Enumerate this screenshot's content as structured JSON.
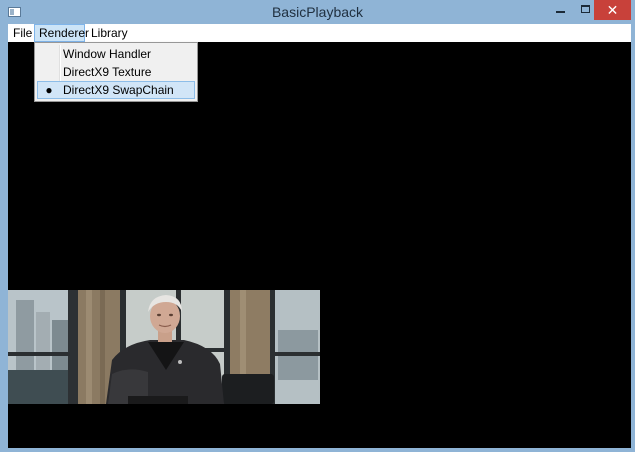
{
  "window": {
    "title": "BasicPlayback",
    "close_glyph": "✕"
  },
  "menubar": {
    "items": [
      {
        "label": "File"
      },
      {
        "label": "Renderer"
      },
      {
        "label": "Library"
      }
    ]
  },
  "renderer_menu": {
    "items": [
      {
        "label": "Window Handler",
        "checked": false,
        "check": ""
      },
      {
        "label": "DirectX9 Texture",
        "checked": false,
        "check": ""
      },
      {
        "label": "DirectX9 SwapChain",
        "checked": true,
        "check": "●"
      }
    ]
  },
  "colors": {
    "frame": "#8fb4d6",
    "close_button": "#c8413a",
    "menu_highlight": "#cce4f7",
    "video_background": "#000000"
  },
  "icons": {
    "app": "app-window-icon",
    "minimize": "minimize-icon",
    "maximize": "maximize-icon",
    "close": "close-icon",
    "check": "radio-bullet-icon"
  }
}
